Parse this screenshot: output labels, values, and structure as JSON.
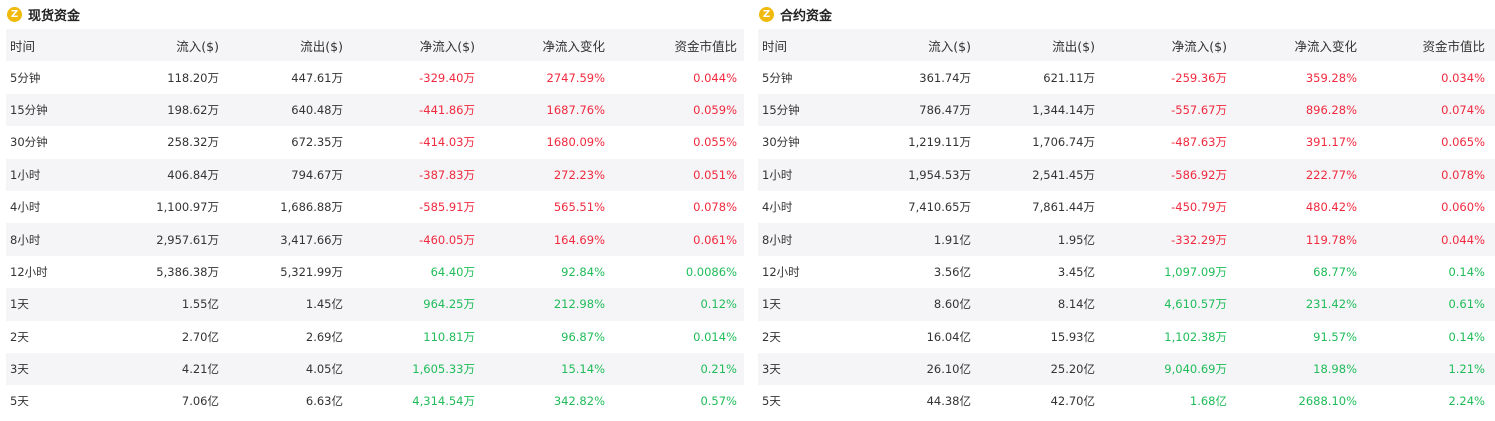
{
  "colors": {
    "negative": "#f0293e",
    "positive": "#1fbc59",
    "coin_icon": "#f0b90b"
  },
  "panels": [
    {
      "title": "现货资金",
      "icon_glyph": "Z",
      "headers": [
        "时间",
        "流入($)",
        "流出($)",
        "净流入($)",
        "净流入变化",
        "资金市值比"
      ],
      "rows": [
        [
          "5分钟",
          "118.20万",
          "447.61万",
          "-329.40万",
          "2747.59%",
          "0.044%"
        ],
        [
          "15分钟",
          "198.62万",
          "640.48万",
          "-441.86万",
          "1687.76%",
          "0.059%"
        ],
        [
          "30分钟",
          "258.32万",
          "672.35万",
          "-414.03万",
          "1680.09%",
          "0.055%"
        ],
        [
          "1小时",
          "406.84万",
          "794.67万",
          "-387.83万",
          "272.23%",
          "0.051%"
        ],
        [
          "4小时",
          "1,100.97万",
          "1,686.88万",
          "-585.91万",
          "565.51%",
          "0.078%"
        ],
        [
          "8小时",
          "2,957.61万",
          "3,417.66万",
          "-460.05万",
          "164.69%",
          "0.061%"
        ],
        [
          "12小时",
          "5,386.38万",
          "5,321.99万",
          "64.40万",
          "92.84%",
          "0.0086%"
        ],
        [
          "1天",
          "1.55亿",
          "1.45亿",
          "964.25万",
          "212.98%",
          "0.12%"
        ],
        [
          "2天",
          "2.70亿",
          "2.69亿",
          "110.81万",
          "96.87%",
          "0.014%"
        ],
        [
          "3天",
          "4.21亿",
          "4.05亿",
          "1,605.33万",
          "15.14%",
          "0.21%"
        ],
        [
          "5天",
          "7.06亿",
          "6.63亿",
          "4,314.54万",
          "342.82%",
          "0.57%"
        ]
      ]
    },
    {
      "title": "合约资金",
      "icon_glyph": "Z",
      "headers": [
        "时间",
        "流入($)",
        "流出($)",
        "净流入($)",
        "净流入变化",
        "资金市值比"
      ],
      "rows": [
        [
          "5分钟",
          "361.74万",
          "621.11万",
          "-259.36万",
          "359.28%",
          "0.034%"
        ],
        [
          "15分钟",
          "786.47万",
          "1,344.14万",
          "-557.67万",
          "896.28%",
          "0.074%"
        ],
        [
          "30分钟",
          "1,219.11万",
          "1,706.74万",
          "-487.63万",
          "391.17%",
          "0.065%"
        ],
        [
          "1小时",
          "1,954.53万",
          "2,541.45万",
          "-586.92万",
          "222.77%",
          "0.078%"
        ],
        [
          "4小时",
          "7,410.65万",
          "7,861.44万",
          "-450.79万",
          "480.42%",
          "0.060%"
        ],
        [
          "8小时",
          "1.91亿",
          "1.95亿",
          "-332.29万",
          "119.78%",
          "0.044%"
        ],
        [
          "12小时",
          "3.56亿",
          "3.45亿",
          "1,097.09万",
          "68.77%",
          "0.14%"
        ],
        [
          "1天",
          "8.60亿",
          "8.14亿",
          "4,610.57万",
          "231.42%",
          "0.61%"
        ],
        [
          "2天",
          "16.04亿",
          "15.93亿",
          "1,102.38万",
          "91.57%",
          "0.14%"
        ],
        [
          "3天",
          "26.10亿",
          "25.20亿",
          "9,040.69万",
          "18.98%",
          "1.21%"
        ],
        [
          "5天",
          "44.38亿",
          "42.70亿",
          "1.68亿",
          "2688.10%",
          "2.24%"
        ]
      ]
    }
  ]
}
